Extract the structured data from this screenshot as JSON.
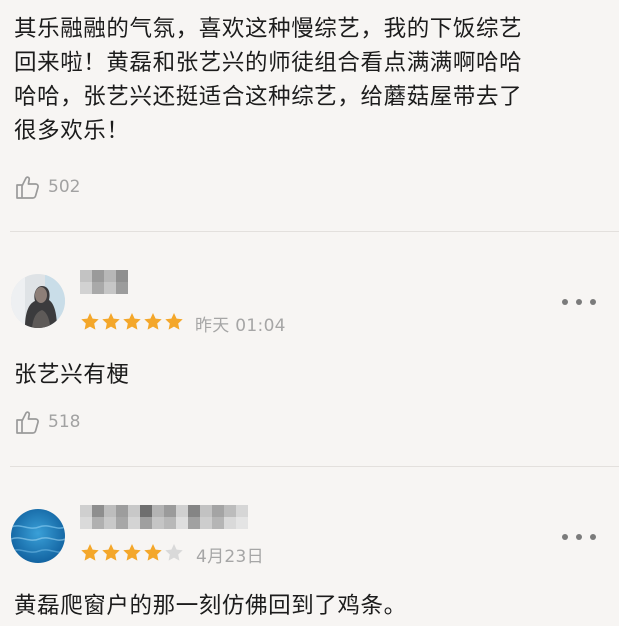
{
  "comments": [
    {
      "text_lines": [
        "其乐融融的气氛，喜欢这种慢综艺，我的下饭综艺",
        "回来啦！黄磊和张艺兴的师徒组合看点满满啊哈哈",
        "哈哈，张艺兴还挺适合这种综艺，给蘑菇屋带去了",
        "很多欢乐！"
      ],
      "likes": "502"
    },
    {
      "user": {
        "name_hidden": true,
        "avatar_icon": "avatar-person-photo-icon"
      },
      "rating": 5,
      "rating_max": 5,
      "timestamp": "昨天 01:04",
      "text": "张艺兴有梗",
      "likes": "518"
    },
    {
      "user": {
        "name_hidden": true,
        "avatar_icon": "avatar-blue-water-icon"
      },
      "rating": 4,
      "rating_max": 5,
      "timestamp": "4月23日",
      "text": "黄磊爬窗户的那一刻仿佛回到了鸡条。"
    }
  ],
  "icons": {
    "like": "thumbs-up-icon",
    "more": "more-dots-icon",
    "star": "star-icon"
  },
  "colors": {
    "background": "#f7f5f3",
    "star_filled": "#f4a72a",
    "star_empty": "#d9d9d9",
    "meta_text": "#a6a6a6",
    "divider": "#e3e0dd"
  }
}
